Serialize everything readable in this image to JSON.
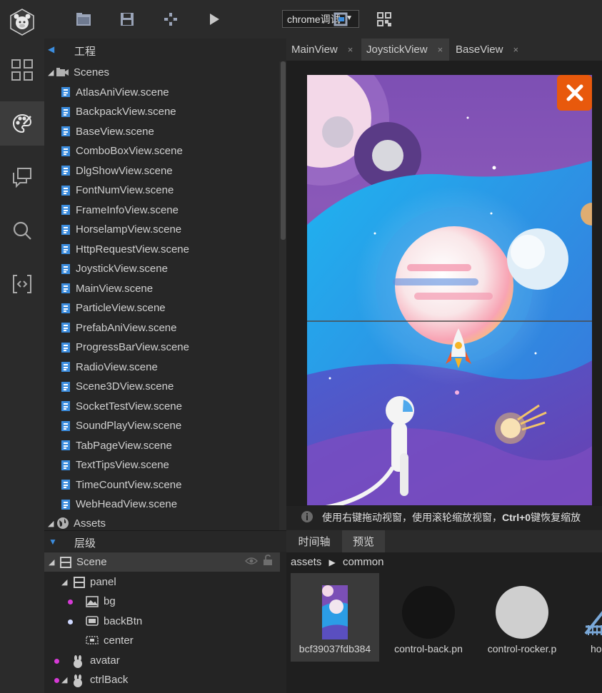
{
  "toolbar": {
    "debug_select": "chrome调试",
    "icons": [
      "logo-icon",
      "folder-icon",
      "save-icon",
      "publish-icon",
      "play-icon",
      "refresh-icon",
      "qrcode-icon"
    ]
  },
  "activity_bar": {
    "items": [
      "assets-grid-icon",
      "palette-icon",
      "comments-icon",
      "search-icon",
      "code-icon"
    ],
    "active": "palette-icon"
  },
  "project": {
    "title": "工程",
    "scenes_folder": "Scenes",
    "scenes": [
      "AtlasAniView.scene",
      "BackpackView.scene",
      "BaseView.scene",
      "ComboBoxView.scene",
      "DlgShowView.scene",
      "FontNumView.scene",
      "FrameInfoView.scene",
      "HorselampView.scene",
      "HttpRequestView.scene",
      "JoystickView.scene",
      "MainView.scene",
      "ParticleView.scene",
      "PrefabAniView.scene",
      "ProgressBarView.scene",
      "RadioView.scene",
      "Scene3DView.scene",
      "SocketTestView.scene",
      "SoundPlayView.scene",
      "TabPageView.scene",
      "TextTipsView.scene",
      "TimeCountView.scene",
      "WebHeadView.scene"
    ],
    "assets_folder": "Assets"
  },
  "hierarchy": {
    "title": "层级",
    "nodes": [
      {
        "label": "Scene",
        "icon": "layout-icon"
      },
      {
        "label": "panel",
        "icon": "layout-icon"
      },
      {
        "label": "bg",
        "icon": "image-icon",
        "dot": "#d63ad6"
      },
      {
        "label": "backBtn",
        "icon": "button-icon",
        "dot": "#cfd9ff"
      },
      {
        "label": "center",
        "icon": "box-icon"
      },
      {
        "label": "avatar",
        "icon": "sprite-icon",
        "dot": "#d63ad6"
      },
      {
        "label": "ctrlBack",
        "icon": "sprite-icon",
        "dot": "#d63ad6"
      }
    ]
  },
  "editor": {
    "tabs": [
      {
        "label": "MainView",
        "active": false
      },
      {
        "label": "JoystickView",
        "active": true
      },
      {
        "label": "BaseView",
        "active": false
      }
    ],
    "status_text": "使用右键拖动视窗，使用滚轮缩放视窗，",
    "status_bold": "Ctrl+0",
    "status_tail": "键恢复缩放"
  },
  "bottom": {
    "tabs": [
      {
        "label": "时间轴",
        "active": false
      },
      {
        "label": "预览",
        "active": true
      }
    ],
    "breadcrumb_root": "assets",
    "breadcrumb_sep": "▶",
    "breadcrumb_leaf": "common",
    "assets": [
      {
        "label": "bcf39037fdb384",
        "selected": true
      },
      {
        "label": "control-back.pn",
        "selected": false
      },
      {
        "label": "control-rocker.p",
        "selected": false
      },
      {
        "label": "ho",
        "selected": false
      }
    ]
  },
  "colors": {
    "accent_close": "#e8590c",
    "scene_dot": "#d63ad6"
  }
}
